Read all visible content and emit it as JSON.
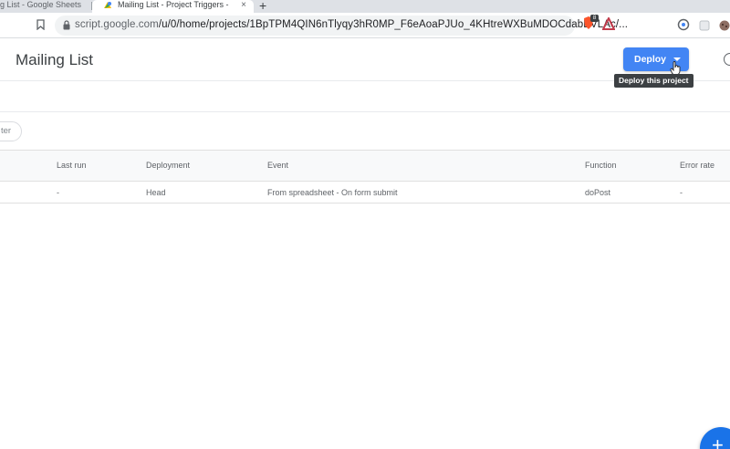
{
  "browser": {
    "tabs": [
      {
        "title": "g List - Google Sheets"
      },
      {
        "title": "Mailing List - Project Triggers - ",
        "close": "×"
      }
    ],
    "new_tab": "+",
    "url_host": "script.google.com",
    "url_path": "/u/0/home/projects/1BpTPM4QIN6nTlyqy3hR0MP_F6eAoaPJUo_4KHtreWXBuMDOCdabBVLAc/...",
    "extension_badge": "8"
  },
  "header": {
    "title": "Mailing List",
    "deploy_label": "Deploy",
    "tooltip": "Deploy this project"
  },
  "filter": {
    "label": "ter"
  },
  "table": {
    "columns": [
      "Last run",
      "Deployment",
      "Event",
      "Function",
      "Error rate"
    ],
    "rows": [
      {
        "last_run": "-",
        "deployment": "Head",
        "event": "From spreadsheet - On form submit",
        "function": "doPost",
        "error_rate": "-"
      }
    ]
  },
  "fab": {
    "label": "+"
  },
  "colors": {
    "accent": "#4285f4",
    "fab": "#1a73e8",
    "tooltip_bg": "#3c4043"
  }
}
